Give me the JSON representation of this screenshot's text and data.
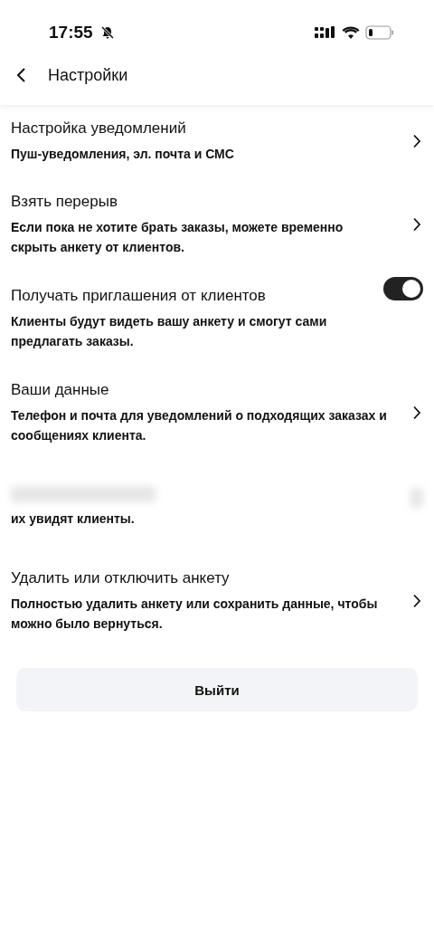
{
  "status_bar": {
    "time": "17:55",
    "silent": true
  },
  "header": {
    "title": "Настройки"
  },
  "items": [
    {
      "kind": "link",
      "title": "Настройка уведомлений",
      "description": "Пуш-уведомления, эл. почта и СМС"
    },
    {
      "kind": "link",
      "title": "Взять перерыв",
      "description": "Если пока не хотите брать заказы, можете временно скрыть анкету от клиентов."
    },
    {
      "kind": "toggle",
      "title": "Получать приглашения от клиентов",
      "description": "Клиенты будут видеть вашу анкету и смогут сами предлагать заказы.",
      "on": true
    },
    {
      "kind": "link",
      "title": "Ваши данные",
      "description": "Телефон и почта для уведомлений о подходящих заказах и сообщениях клиента."
    },
    {
      "kind": "redacted",
      "description": "их увидят клиенты."
    },
    {
      "kind": "link",
      "title": "Удалить или отключить анкету",
      "description": "Полностью удалить анкету или сохранить данные, чтобы можно было вернуться."
    }
  ],
  "logout_button": "Выйти"
}
